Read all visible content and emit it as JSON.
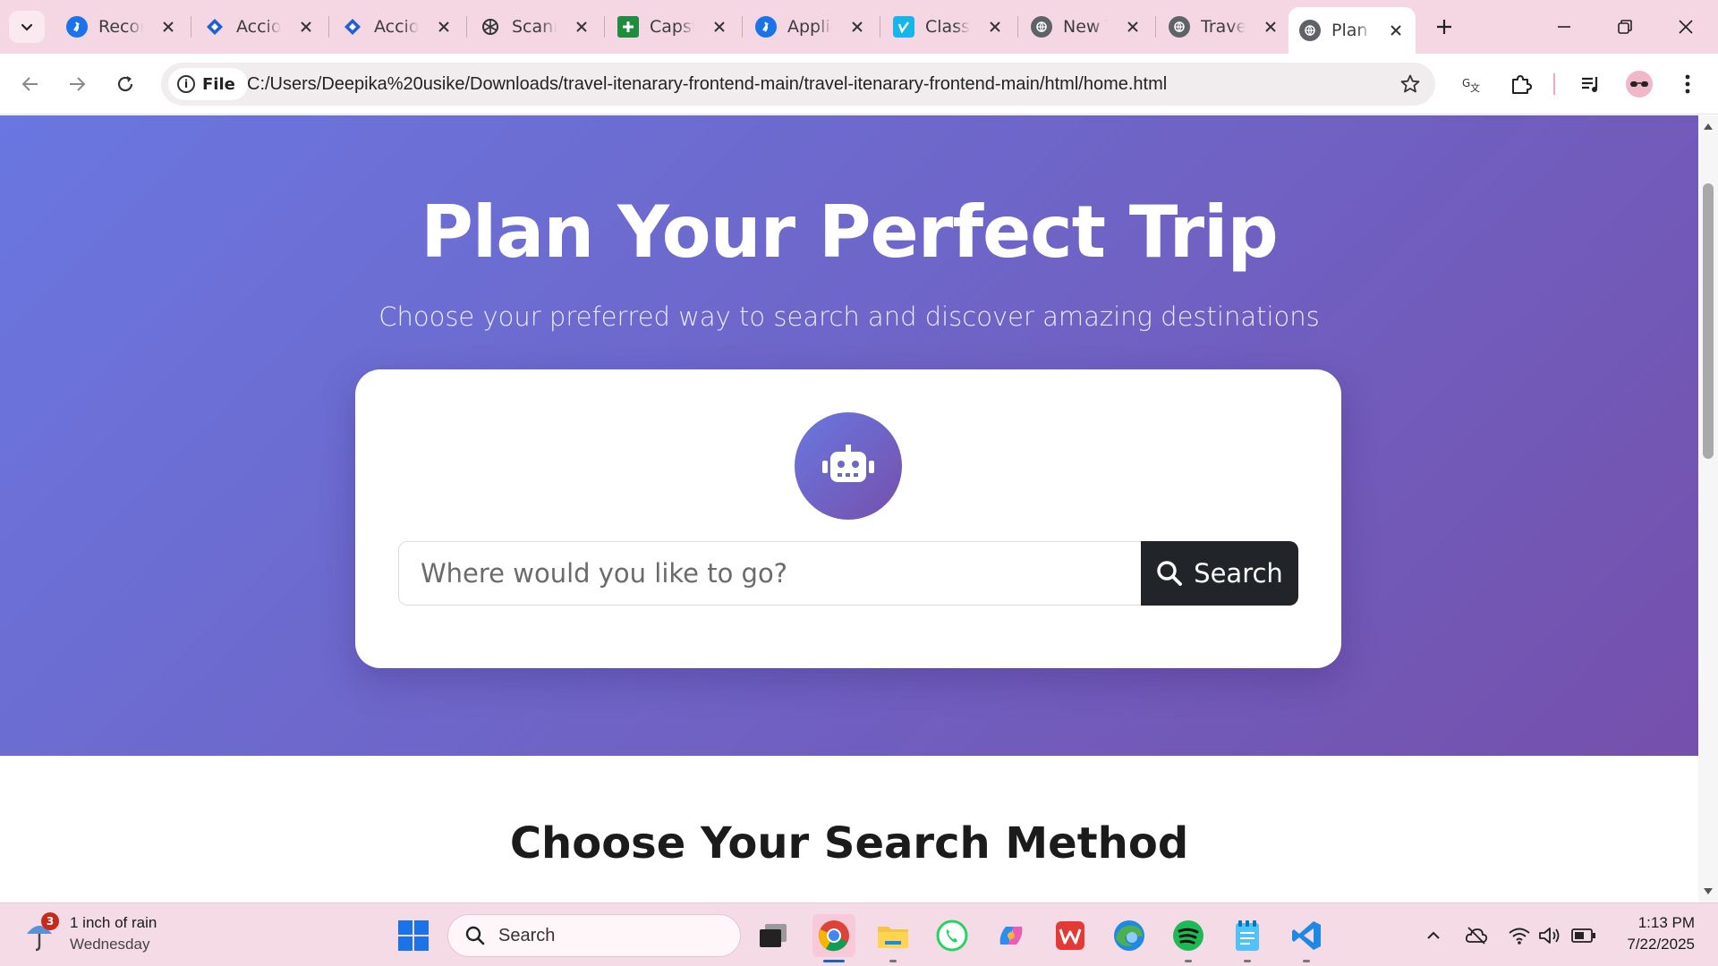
{
  "browser": {
    "tabs": [
      {
        "title": "Recon",
        "favicon": "globe-blue-icon",
        "color": "#1a73e8"
      },
      {
        "title": "Accio",
        "favicon": "acciojob-icon",
        "color": "#1f5fd6"
      },
      {
        "title": "Accio",
        "favicon": "acciojob-icon",
        "color": "#1f5fd6"
      },
      {
        "title": "Scann",
        "favicon": "chatgpt-icon",
        "color": "#333333"
      },
      {
        "title": "Capst",
        "favicon": "google-sheets-icon",
        "color": "#1e8e3e"
      },
      {
        "title": "Applic",
        "favicon": "globe-blue-icon",
        "color": "#1a73e8"
      },
      {
        "title": "Class",
        "favicon": "vimeo-icon",
        "color": "#17b5ea"
      },
      {
        "title": "New T",
        "favicon": "globe-grey-icon",
        "color": "#5f6368"
      },
      {
        "title": "Travel",
        "favicon": "globe-grey-icon",
        "color": "#5f6368"
      },
      {
        "title": "Plan Y",
        "favicon": "globe-grey-icon",
        "color": "#5f6368",
        "active": true
      }
    ],
    "address": {
      "chip_label": "File",
      "url": "C:/Users/Deepika%20usike/Downloads/travel-itenarary-frontend-main/travel-itenarary-frontend-main/html/home.html"
    }
  },
  "page": {
    "hero": {
      "title": "Plan Your Perfect Trip",
      "subtitle": "Choose your preferred way to search and discover amazing destinations"
    },
    "search": {
      "placeholder": "Where would you like to go?",
      "button_label": "Search"
    },
    "section_title": "Choose Your Search Method"
  },
  "taskbar": {
    "weather": {
      "badge": "3",
      "line1": "1 inch of rain",
      "line2": "Wednesday"
    },
    "search_label": "Search",
    "clock": {
      "time": "1:13 PM",
      "date": "7/22/2025"
    }
  },
  "colors": {
    "hero_gradient_start": "#6a77e0",
    "hero_gradient_end": "#7550ac",
    "search_button": "#212529",
    "tabstrip": "#f5d6e3"
  }
}
